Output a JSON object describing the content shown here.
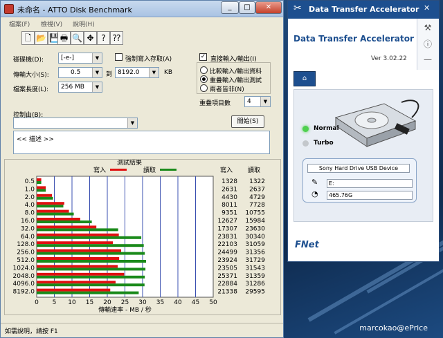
{
  "atto": {
    "title": "未命名 - ATTO Disk Benchmark",
    "menu": [
      "檔案(F)",
      "檢視(V)",
      "說明(H)"
    ],
    "drive_label": "磁碟機(D):",
    "drive_value": "[-e-]",
    "force_write_label": "強制寫入存取(A)",
    "direct_io_label": "直接輸入/輸出(I)",
    "transfer_size_label": "傳輸大小(S):",
    "transfer_from": "0.5",
    "to_label": "到",
    "transfer_to": "8192.0",
    "kb_label": "KB",
    "file_length_label": "檔案長度(L):",
    "file_length_value": "256 MB",
    "options": [
      "比較輸入/輸出資料",
      "重疊輸入/輸出測試",
      "兩者皆非(N)"
    ],
    "queue_depth_label": "重疊項目數",
    "queue_depth_value": "4",
    "controlled_by_label": "控制由(B):",
    "start_button": "開始(S)",
    "description_text": "<<   描述   >>",
    "status_text": "如需說明，請按 F1"
  },
  "chart_data": {
    "type": "bar",
    "title": "測試結果",
    "legend_write": "寫入",
    "legend_read": "讀取",
    "xlabel": "傳輸速率 - MB / 秒",
    "xlim": [
      0,
      50
    ],
    "xticks": [
      "0",
      "5",
      "10",
      "15",
      "20",
      "25",
      "30",
      "35",
      "40",
      "45",
      "50"
    ],
    "col_write": "寫入",
    "col_read": "讀取",
    "write_color": "#e01010",
    "read_color": "#1a8a1a",
    "categories": [
      "0.5",
      "1.0",
      "2.0",
      "4.0",
      "8.0",
      "16.0",
      "32.0",
      "64.0",
      "128.0",
      "256.0",
      "512.0",
      "1024.0",
      "2048.0",
      "4096.0",
      "8192.0"
    ],
    "series": [
      {
        "name": "寫入",
        "values": [
          1328,
          2631,
          4430,
          8011,
          9351,
          12627,
          17307,
          23831,
          22103,
          24499,
          23924,
          23505,
          25371,
          22884,
          21338
        ]
      },
      {
        "name": "讀取",
        "values": [
          1322,
          2637,
          4729,
          7728,
          10755,
          15984,
          23630,
          30340,
          31059,
          31356,
          31729,
          31543,
          31359,
          31286,
          29595
        ]
      }
    ]
  },
  "fnet": {
    "title": "Data Transfer Accelerator",
    "heading": "Data Transfer Accelerator",
    "version": "Ver 3.02.22",
    "mode_normal": "Normal",
    "mode_turbo": "Turbo",
    "device_name": "Sony Hard Drive USB Device",
    "drive_letter": "E:",
    "capacity": "465.76G",
    "logo": "FNet",
    "led_on_color": "#4fd04f",
    "accent_color": "#1d4f8f"
  },
  "watermark": "marcokao@ePrice"
}
